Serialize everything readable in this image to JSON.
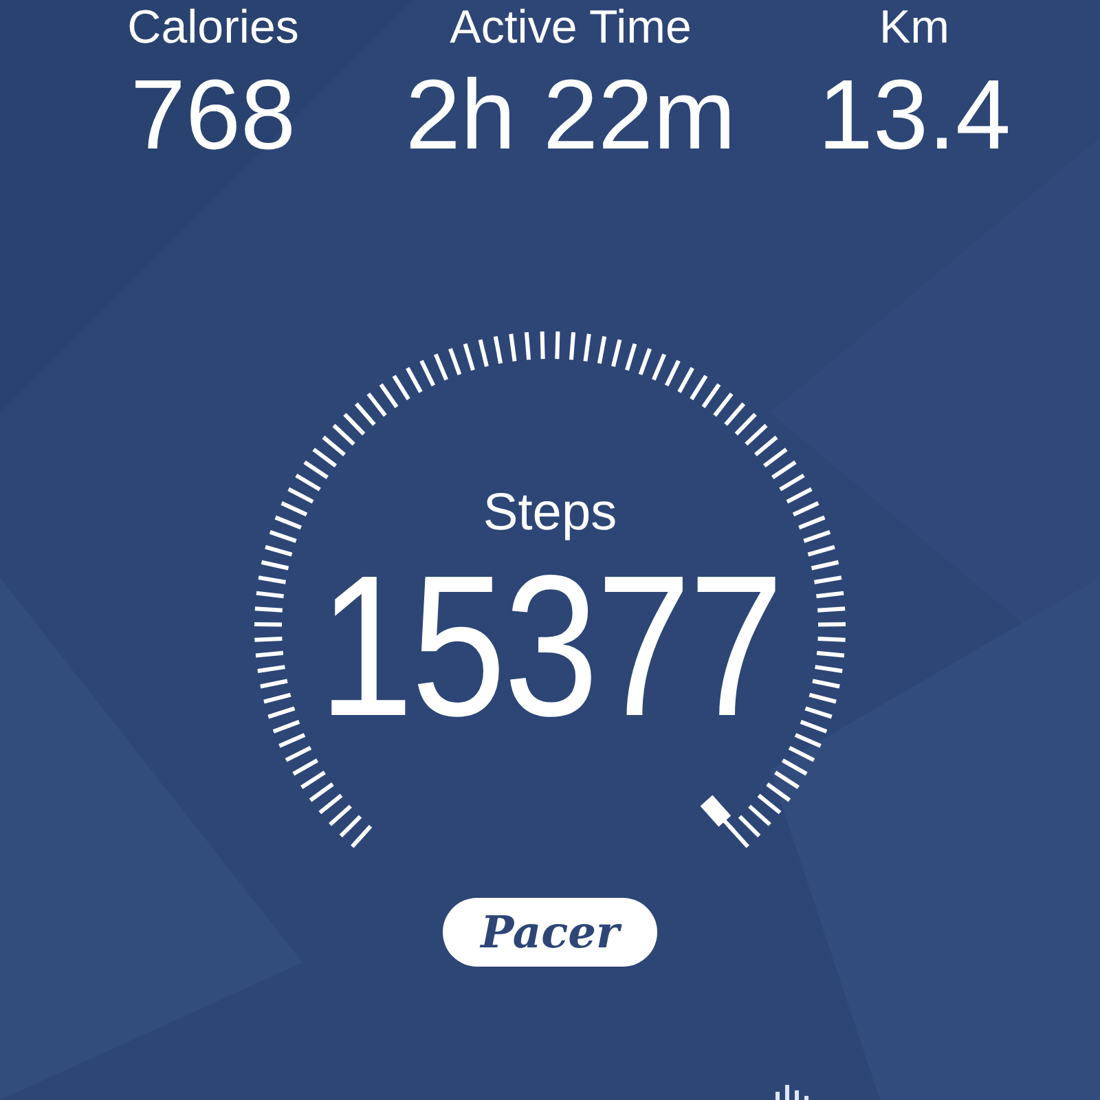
{
  "stats": [
    {
      "label": "Calories",
      "value": "768"
    },
    {
      "label": "Active Time",
      "value": "2h 22m"
    },
    {
      "label": "Km",
      "value": "13.4"
    }
  ],
  "gauge": {
    "label": "Steps",
    "value": "15377"
  },
  "logo": "Pacer"
}
